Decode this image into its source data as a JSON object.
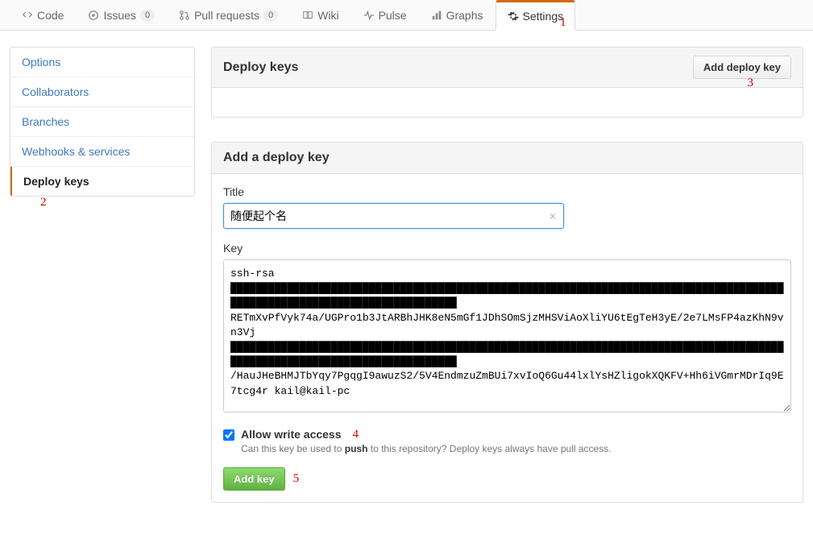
{
  "topnav": {
    "code": "Code",
    "issues": "Issues",
    "issues_count": "0",
    "pull_requests": "Pull requests",
    "pr_count": "0",
    "wiki": "Wiki",
    "pulse": "Pulse",
    "graphs": "Graphs",
    "settings": "Settings"
  },
  "sidebar": {
    "options": "Options",
    "collaborators": "Collaborators",
    "branches": "Branches",
    "webhooks": "Webhooks & services",
    "deploy_keys": "Deploy keys"
  },
  "deploy_keys_panel": {
    "title": "Deploy keys",
    "add_button": "Add deploy key"
  },
  "add_key_panel": {
    "title": "Add a deploy key",
    "title_label": "Title",
    "title_value": "随便起个名",
    "key_label": "Key",
    "key_value": "ssh-rsa\n████████████████████████████████████████████████████████████████████████████████████████████████████████████████████████████\nRETmXvPfVyk74a/UGPro1b3JtARBhJHK8eN5mGf1JDhSOmSjzMHSViAoXliYU6tEgTeH3yE/2e7LMsFP4azKhN9vn3Vj\n████████████████████████████████████████████████████████████████████████████████████████████████████████████████████████████\n/HauJHeBHMJTbYqy7PgqgI9awuzS2/5V4EndmzuZmBUi7xvIoQ6Gu44lxlYsHZligokXQKFV+Hh6iVGmrMDrIq9E7tcg4r kail@kail-pc",
    "allow_write": "Allow write access",
    "allow_write_help_pre": "Can this key be used to ",
    "allow_write_help_bold": "push",
    "allow_write_help_post": " to this repository? Deploy keys always have pull access.",
    "add_key_button": "Add key"
  },
  "annotations": {
    "a1": "1",
    "a2": "2",
    "a3": "3",
    "a4": "4",
    "a5": "5"
  }
}
